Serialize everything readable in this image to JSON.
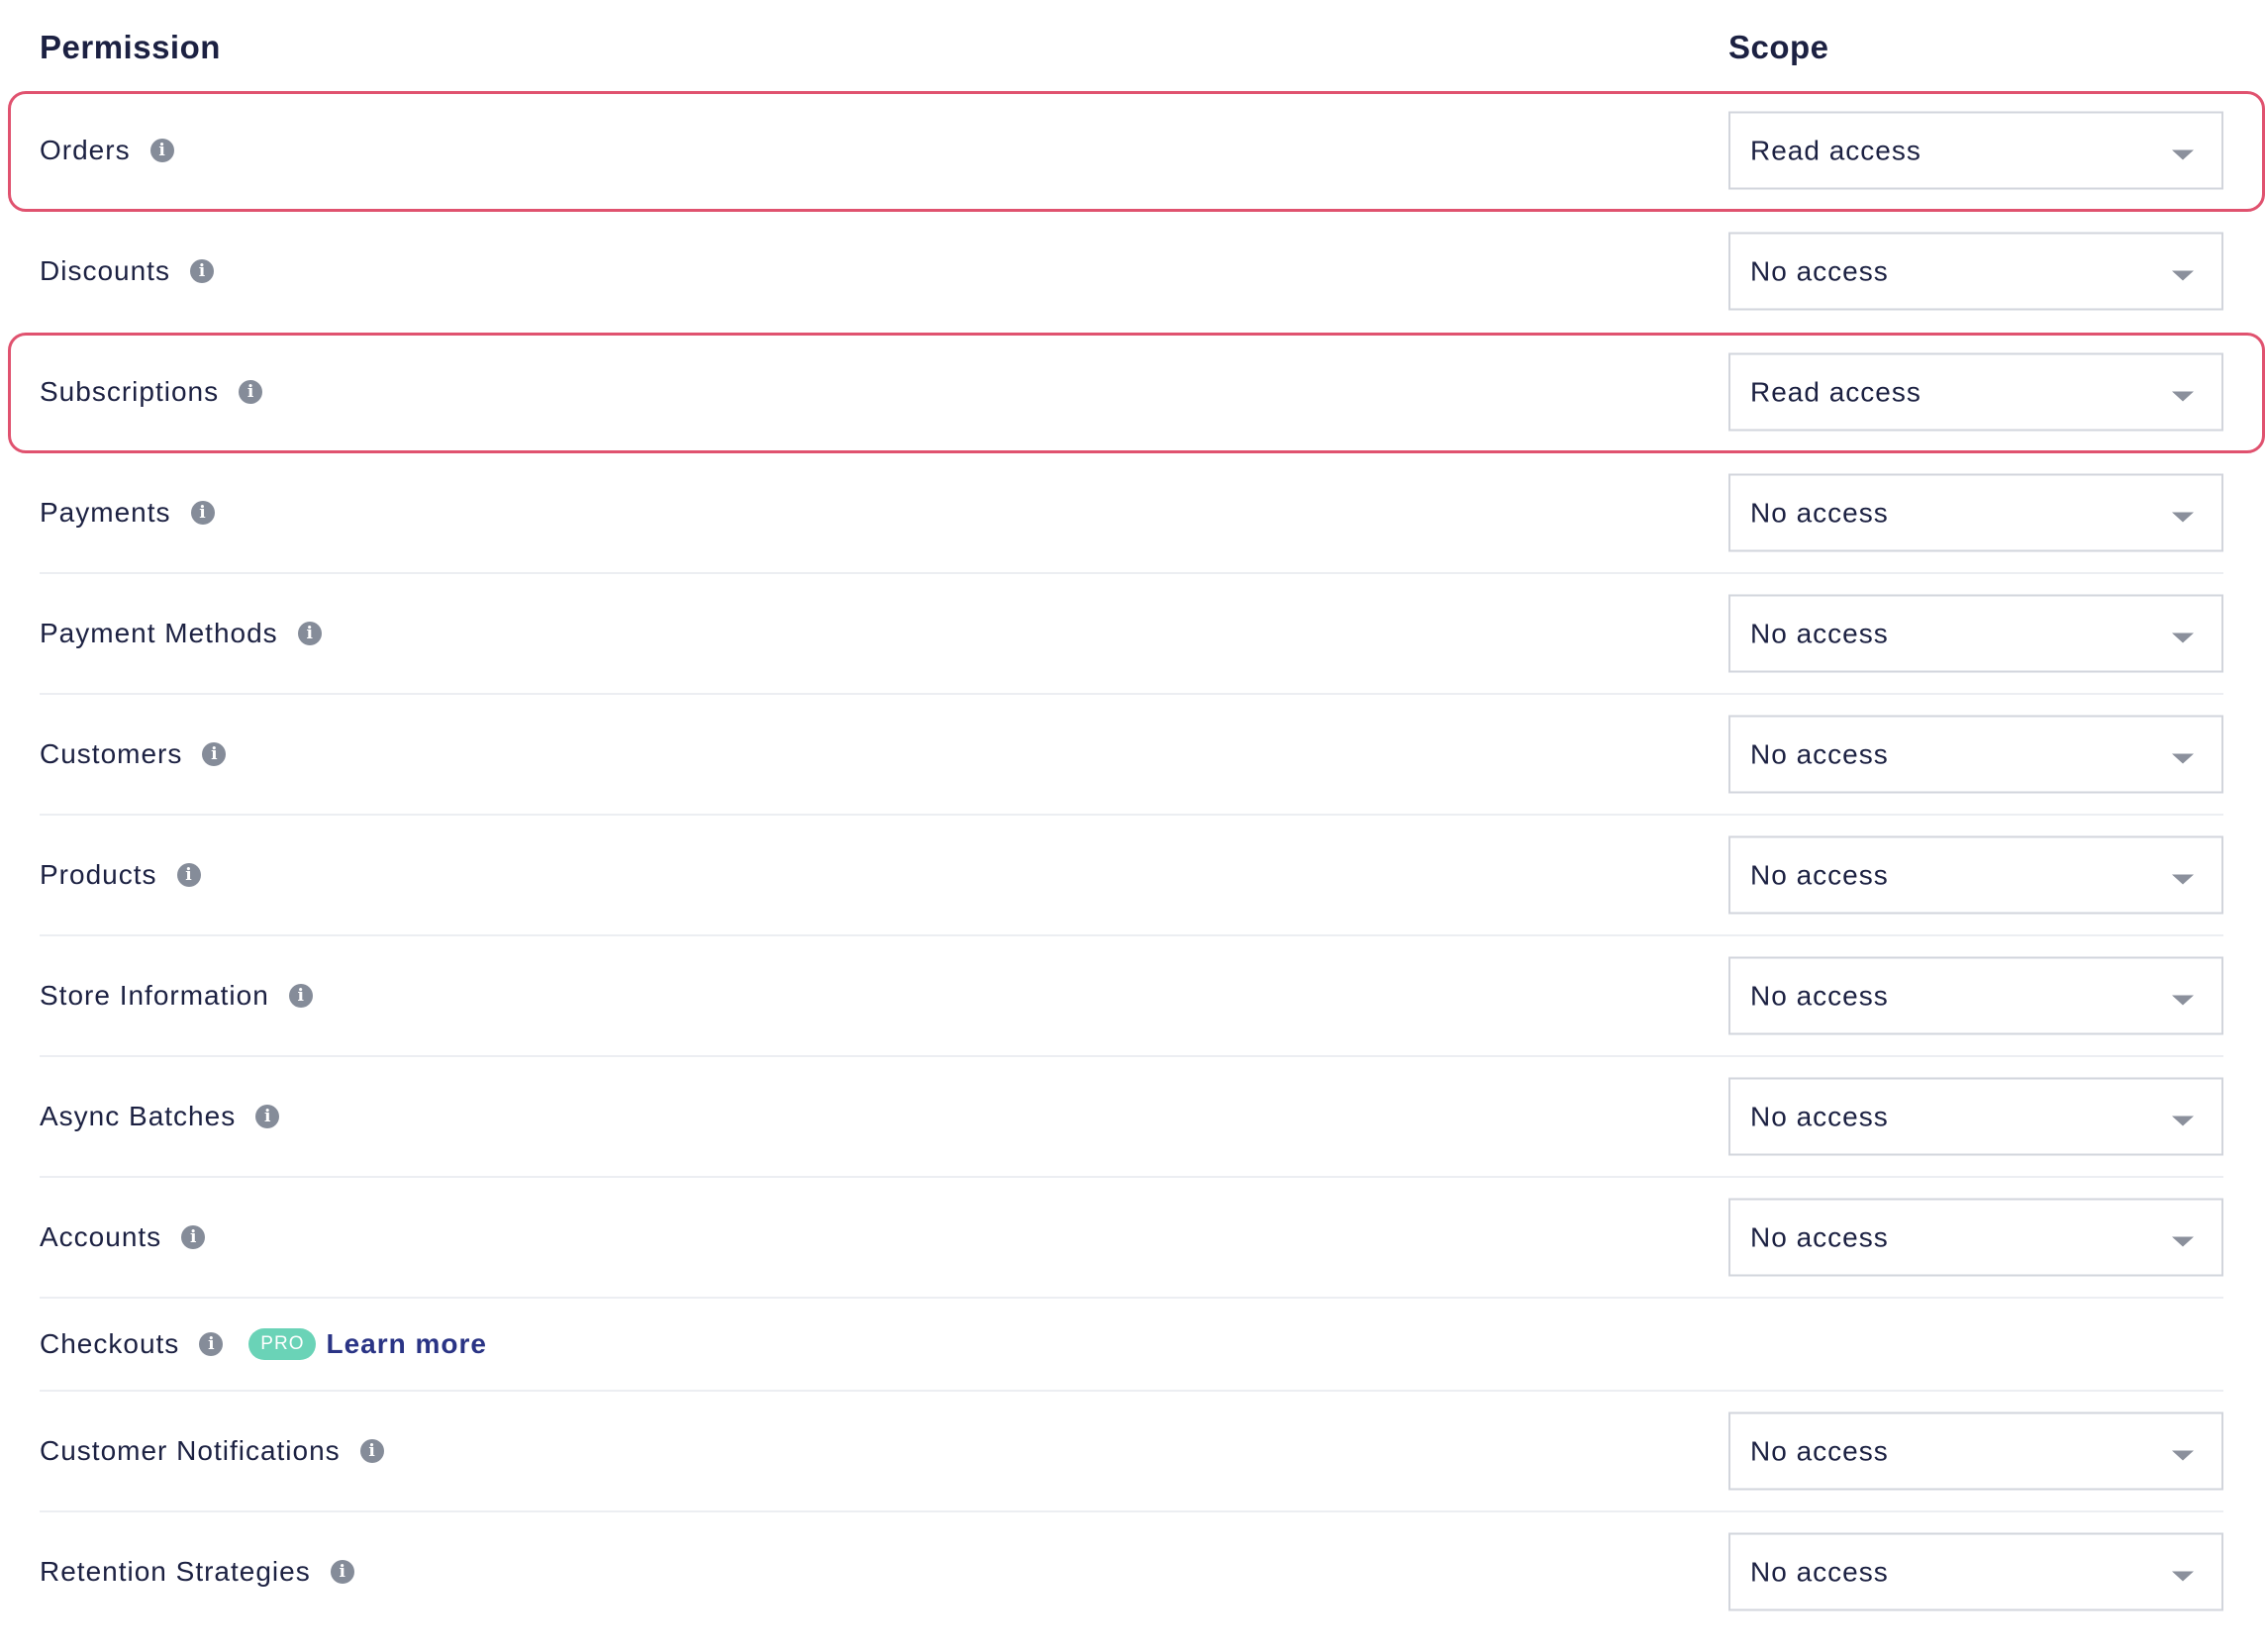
{
  "header": {
    "permission_label": "Permission",
    "scope_label": "Scope"
  },
  "permissions": [
    {
      "label": "Orders",
      "scope": "Read access",
      "highlighted": true
    },
    {
      "label": "Discounts",
      "scope": "No access",
      "highlighted": false
    },
    {
      "label": "Subscriptions",
      "scope": "Read access",
      "highlighted": true
    },
    {
      "label": "Payments",
      "scope": "No access",
      "highlighted": false
    },
    {
      "label": "Payment Methods",
      "scope": "No access",
      "highlighted": false
    },
    {
      "label": "Customers",
      "scope": "No access",
      "highlighted": false
    },
    {
      "label": "Products",
      "scope": "No access",
      "highlighted": false
    },
    {
      "label": "Store Information",
      "scope": "No access",
      "highlighted": false
    },
    {
      "label": "Async Batches",
      "scope": "No access",
      "highlighted": false
    },
    {
      "label": "Accounts",
      "scope": "No access",
      "highlighted": false
    },
    {
      "label": "Checkouts",
      "badge": "PRO",
      "link": "Learn more"
    },
    {
      "label": "Customer Notifications",
      "scope": "No access",
      "highlighted": false
    },
    {
      "label": "Retention Strategies",
      "scope": "No access",
      "highlighted": false
    }
  ],
  "icons": {
    "info": "info-icon",
    "dropdown": "chevron-down-icon"
  },
  "colors": {
    "highlight_border": "#e0526f",
    "pro_badge": "#6ad3b7",
    "link": "#2a3485",
    "text": "#1c2142",
    "info_icon": "#858c99"
  }
}
